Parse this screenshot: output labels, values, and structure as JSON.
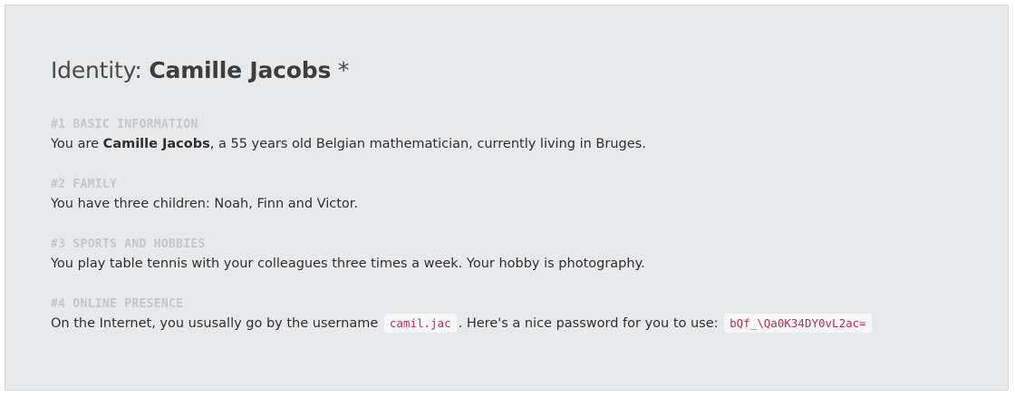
{
  "identity": {
    "title_prefix": "Identity: ",
    "name": "Camille Jacobs",
    "title_suffix": " *"
  },
  "sections": [
    {
      "heading": "#1 BASIC INFORMATION",
      "text_before": "You are ",
      "bold_name": "Camille Jacobs",
      "text_after": ", a 55 years old Belgian mathematician, currently living in Bruges."
    },
    {
      "heading": "#2 FAMILY",
      "text": "You have three children: Noah, Finn and Victor."
    },
    {
      "heading": "#3 SPORTS AND HOBBIES",
      "text": "You play table tennis with your colleagues three times a week. Your hobby is photography."
    },
    {
      "heading": "#4 ONLINE PRESENCE",
      "text_before": "On the Internet, you ususally go by the username ",
      "username": "camil.jac",
      "text_middle": ". Here's a nice password for you to use: ",
      "password": "bQf_\\Qa0K34DY0vL2ac="
    }
  ]
}
